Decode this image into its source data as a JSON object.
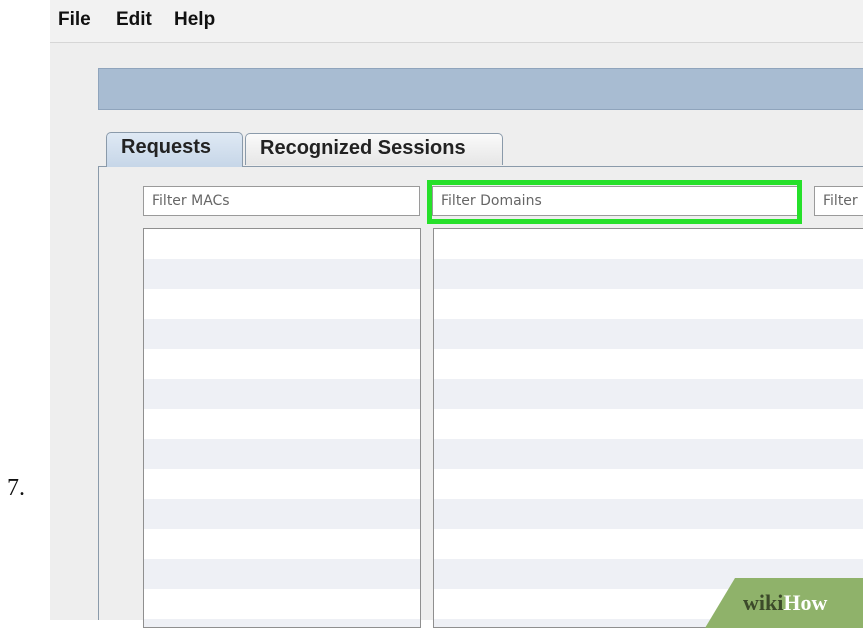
{
  "step": {
    "number": "7."
  },
  "menu": {
    "file": "File",
    "edit": "Edit",
    "help": "Help"
  },
  "tabs": [
    {
      "label": "Requests",
      "selected": true
    },
    {
      "label": "Recognized Sessions",
      "selected": false
    }
  ],
  "filters": {
    "macs_placeholder": "Filter MACs",
    "domains_placeholder": "Filter Domains",
    "third_placeholder": "Filter"
  },
  "highlight": {
    "color": "#26e02a",
    "target": "Filter Domains"
  },
  "watermark": {
    "part1": "wiki",
    "part2": "How"
  },
  "colors": {
    "progress_bar": "#a8bcd2",
    "selected_tab": "#c6d6e8",
    "row_alt": "#eef0f5"
  }
}
